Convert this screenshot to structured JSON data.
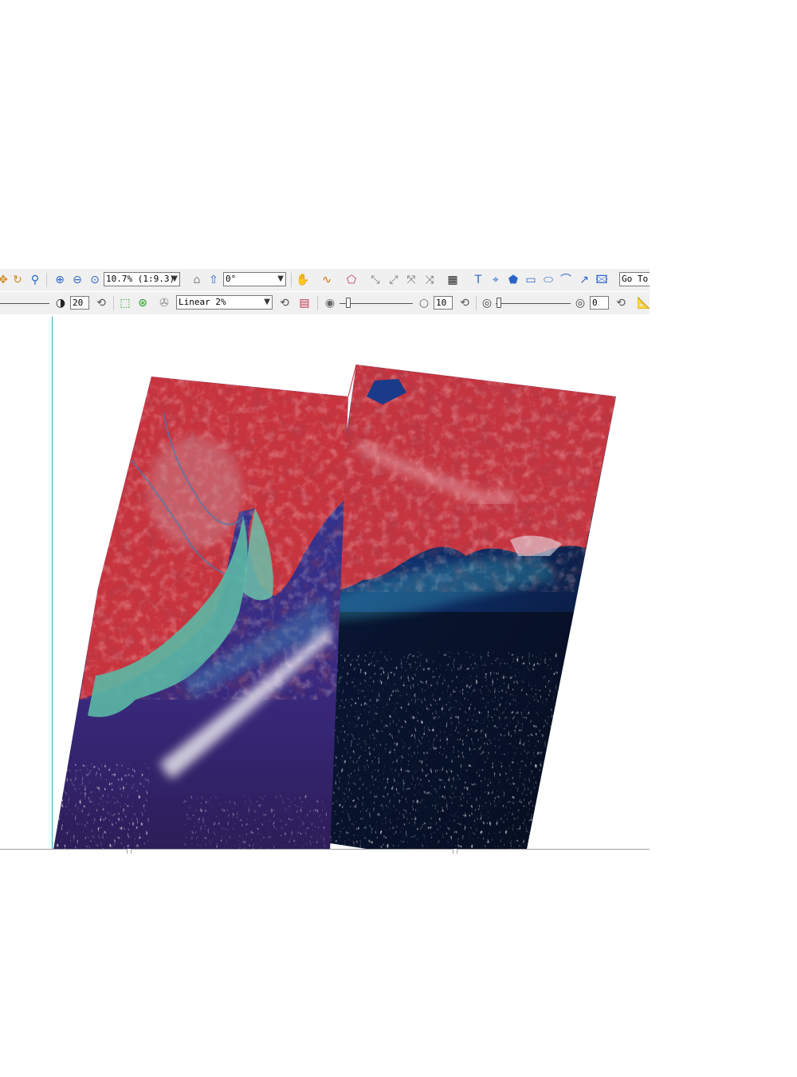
{
  "toolbar1": {
    "zoom_value": "10.7% (1:9.3)",
    "rotation_value": "0°",
    "goto_label": "Go To",
    "icons": [
      "pan-icon",
      "rotate-icon",
      "magnifier-icon",
      "zoom-in-icon",
      "zoom-out-icon",
      "zoom-fit-icon",
      "home-view-icon",
      "up-layer-icon",
      "cursor-value-icon",
      "spectral-profile-icon",
      "roi-icon",
      "vector-edit-icon",
      "vector-add-icon",
      "vector-select-icon",
      "vector-join-icon",
      "grid-icon",
      "text-annotation-icon",
      "crosshair-icon",
      "polygon-annotation-icon",
      "rectangle-annotation-icon",
      "ellipse-annotation-icon",
      "polyline-annotation-icon",
      "arrow-annotation-icon",
      "picture-annotation-icon"
    ]
  },
  "toolbar2": {
    "brightness_value": "20",
    "stretch_value": "Linear 2%",
    "sharpen_value": "10",
    "transparency_value": "0",
    "icons": [
      "contrast-icon",
      "reset-icon",
      "extent-icon",
      "full-extent-icon",
      "stretch-icon",
      "reset-stretch-icon",
      "histogram-icon",
      "sharpen-icon",
      "reset-sharpen-icon",
      "transparency-icon",
      "reset-transparency-icon",
      "measure-icon"
    ]
  },
  "colors": {
    "toolbar_bg": "#f0f0f0",
    "vegetation_red": "#c8323c",
    "urban_pink": "#c8828c",
    "turbid_cyan": "#5ab4a0",
    "sea_blue": "#1e3c8c",
    "deep_sea": "#0a1428",
    "view_divider": "#3aa8c8"
  }
}
